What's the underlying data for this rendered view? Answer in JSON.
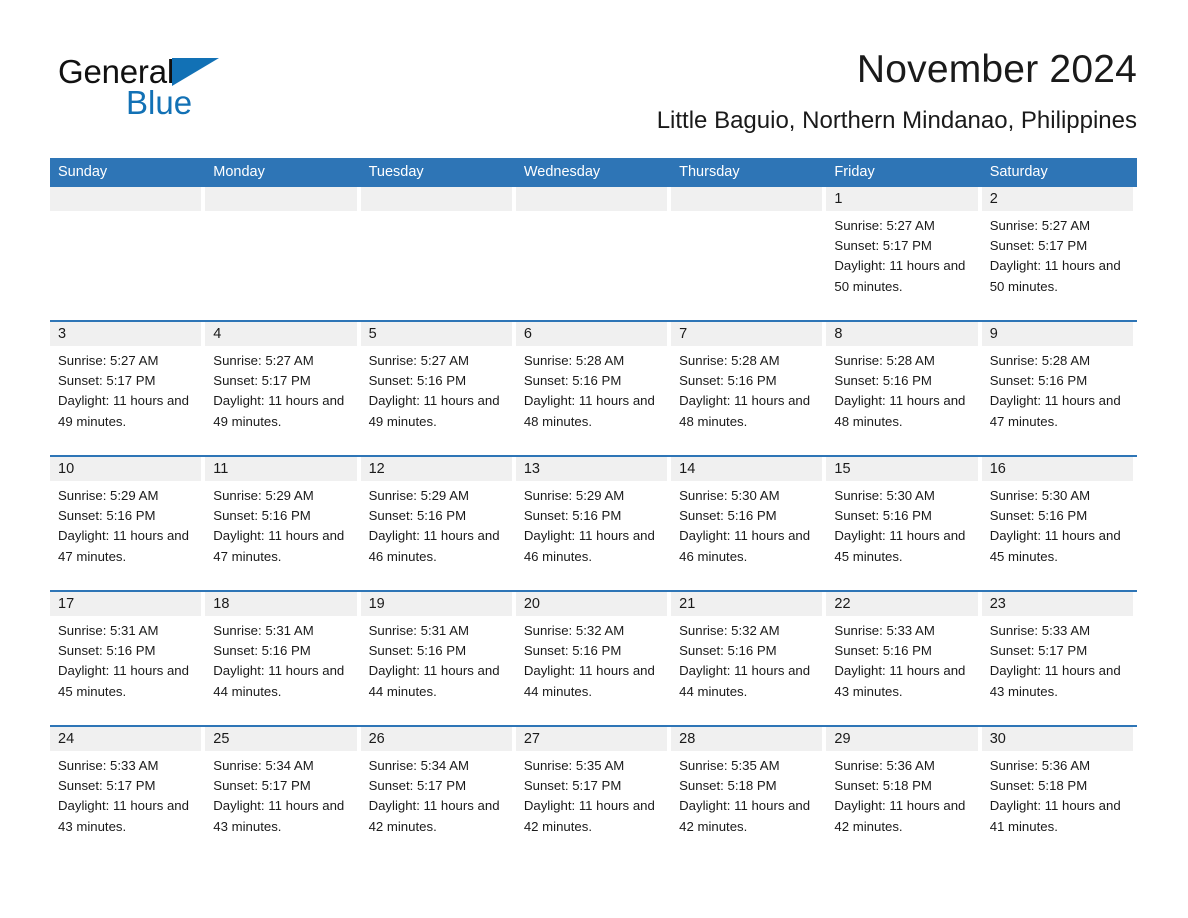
{
  "brand": {
    "name_part1": "General",
    "name_part2": "Blue",
    "accent_color": "#1271B5",
    "triangle_icon": "triangle-icon"
  },
  "header": {
    "title": "November 2024",
    "subtitle": "Little Baguio, Northern Mindanao, Philippines"
  },
  "colors": {
    "header_blue": "#2E75B6",
    "day_strip_gray": "#F0F0F0",
    "text": "#1a1a1a"
  },
  "weekdays": [
    "Sunday",
    "Monday",
    "Tuesday",
    "Wednesday",
    "Thursday",
    "Friday",
    "Saturday"
  ],
  "weeks": [
    [
      {
        "day": "",
        "sunrise": "",
        "sunset": "",
        "daylight": ""
      },
      {
        "day": "",
        "sunrise": "",
        "sunset": "",
        "daylight": ""
      },
      {
        "day": "",
        "sunrise": "",
        "sunset": "",
        "daylight": ""
      },
      {
        "day": "",
        "sunrise": "",
        "sunset": "",
        "daylight": ""
      },
      {
        "day": "",
        "sunrise": "",
        "sunset": "",
        "daylight": ""
      },
      {
        "day": "1",
        "sunrise": "Sunrise: 5:27 AM",
        "sunset": "Sunset: 5:17 PM",
        "daylight": "Daylight: 11 hours and 50 minutes."
      },
      {
        "day": "2",
        "sunrise": "Sunrise: 5:27 AM",
        "sunset": "Sunset: 5:17 PM",
        "daylight": "Daylight: 11 hours and 50 minutes."
      }
    ],
    [
      {
        "day": "3",
        "sunrise": "Sunrise: 5:27 AM",
        "sunset": "Sunset: 5:17 PM",
        "daylight": "Daylight: 11 hours and 49 minutes."
      },
      {
        "day": "4",
        "sunrise": "Sunrise: 5:27 AM",
        "sunset": "Sunset: 5:17 PM",
        "daylight": "Daylight: 11 hours and 49 minutes."
      },
      {
        "day": "5",
        "sunrise": "Sunrise: 5:27 AM",
        "sunset": "Sunset: 5:16 PM",
        "daylight": "Daylight: 11 hours and 49 minutes."
      },
      {
        "day": "6",
        "sunrise": "Sunrise: 5:28 AM",
        "sunset": "Sunset: 5:16 PM",
        "daylight": "Daylight: 11 hours and 48 minutes."
      },
      {
        "day": "7",
        "sunrise": "Sunrise: 5:28 AM",
        "sunset": "Sunset: 5:16 PM",
        "daylight": "Daylight: 11 hours and 48 minutes."
      },
      {
        "day": "8",
        "sunrise": "Sunrise: 5:28 AM",
        "sunset": "Sunset: 5:16 PM",
        "daylight": "Daylight: 11 hours and 48 minutes."
      },
      {
        "day": "9",
        "sunrise": "Sunrise: 5:28 AM",
        "sunset": "Sunset: 5:16 PM",
        "daylight": "Daylight: 11 hours and 47 minutes."
      }
    ],
    [
      {
        "day": "10",
        "sunrise": "Sunrise: 5:29 AM",
        "sunset": "Sunset: 5:16 PM",
        "daylight": "Daylight: 11 hours and 47 minutes."
      },
      {
        "day": "11",
        "sunrise": "Sunrise: 5:29 AM",
        "sunset": "Sunset: 5:16 PM",
        "daylight": "Daylight: 11 hours and 47 minutes."
      },
      {
        "day": "12",
        "sunrise": "Sunrise: 5:29 AM",
        "sunset": "Sunset: 5:16 PM",
        "daylight": "Daylight: 11 hours and 46 minutes."
      },
      {
        "day": "13",
        "sunrise": "Sunrise: 5:29 AM",
        "sunset": "Sunset: 5:16 PM",
        "daylight": "Daylight: 11 hours and 46 minutes."
      },
      {
        "day": "14",
        "sunrise": "Sunrise: 5:30 AM",
        "sunset": "Sunset: 5:16 PM",
        "daylight": "Daylight: 11 hours and 46 minutes."
      },
      {
        "day": "15",
        "sunrise": "Sunrise: 5:30 AM",
        "sunset": "Sunset: 5:16 PM",
        "daylight": "Daylight: 11 hours and 45 minutes."
      },
      {
        "day": "16",
        "sunrise": "Sunrise: 5:30 AM",
        "sunset": "Sunset: 5:16 PM",
        "daylight": "Daylight: 11 hours and 45 minutes."
      }
    ],
    [
      {
        "day": "17",
        "sunrise": "Sunrise: 5:31 AM",
        "sunset": "Sunset: 5:16 PM",
        "daylight": "Daylight: 11 hours and 45 minutes."
      },
      {
        "day": "18",
        "sunrise": "Sunrise: 5:31 AM",
        "sunset": "Sunset: 5:16 PM",
        "daylight": "Daylight: 11 hours and 44 minutes."
      },
      {
        "day": "19",
        "sunrise": "Sunrise: 5:31 AM",
        "sunset": "Sunset: 5:16 PM",
        "daylight": "Daylight: 11 hours and 44 minutes."
      },
      {
        "day": "20",
        "sunrise": "Sunrise: 5:32 AM",
        "sunset": "Sunset: 5:16 PM",
        "daylight": "Daylight: 11 hours and 44 minutes."
      },
      {
        "day": "21",
        "sunrise": "Sunrise: 5:32 AM",
        "sunset": "Sunset: 5:16 PM",
        "daylight": "Daylight: 11 hours and 44 minutes."
      },
      {
        "day": "22",
        "sunrise": "Sunrise: 5:33 AM",
        "sunset": "Sunset: 5:16 PM",
        "daylight": "Daylight: 11 hours and 43 minutes."
      },
      {
        "day": "23",
        "sunrise": "Sunrise: 5:33 AM",
        "sunset": "Sunset: 5:17 PM",
        "daylight": "Daylight: 11 hours and 43 minutes."
      }
    ],
    [
      {
        "day": "24",
        "sunrise": "Sunrise: 5:33 AM",
        "sunset": "Sunset: 5:17 PM",
        "daylight": "Daylight: 11 hours and 43 minutes."
      },
      {
        "day": "25",
        "sunrise": "Sunrise: 5:34 AM",
        "sunset": "Sunset: 5:17 PM",
        "daylight": "Daylight: 11 hours and 43 minutes."
      },
      {
        "day": "26",
        "sunrise": "Sunrise: 5:34 AM",
        "sunset": "Sunset: 5:17 PM",
        "daylight": "Daylight: 11 hours and 42 minutes."
      },
      {
        "day": "27",
        "sunrise": "Sunrise: 5:35 AM",
        "sunset": "Sunset: 5:17 PM",
        "daylight": "Daylight: 11 hours and 42 minutes."
      },
      {
        "day": "28",
        "sunrise": "Sunrise: 5:35 AM",
        "sunset": "Sunset: 5:18 PM",
        "daylight": "Daylight: 11 hours and 42 minutes."
      },
      {
        "day": "29",
        "sunrise": "Sunrise: 5:36 AM",
        "sunset": "Sunset: 5:18 PM",
        "daylight": "Daylight: 11 hours and 42 minutes."
      },
      {
        "day": "30",
        "sunrise": "Sunrise: 5:36 AM",
        "sunset": "Sunset: 5:18 PM",
        "daylight": "Daylight: 11 hours and 41 minutes."
      }
    ]
  ]
}
